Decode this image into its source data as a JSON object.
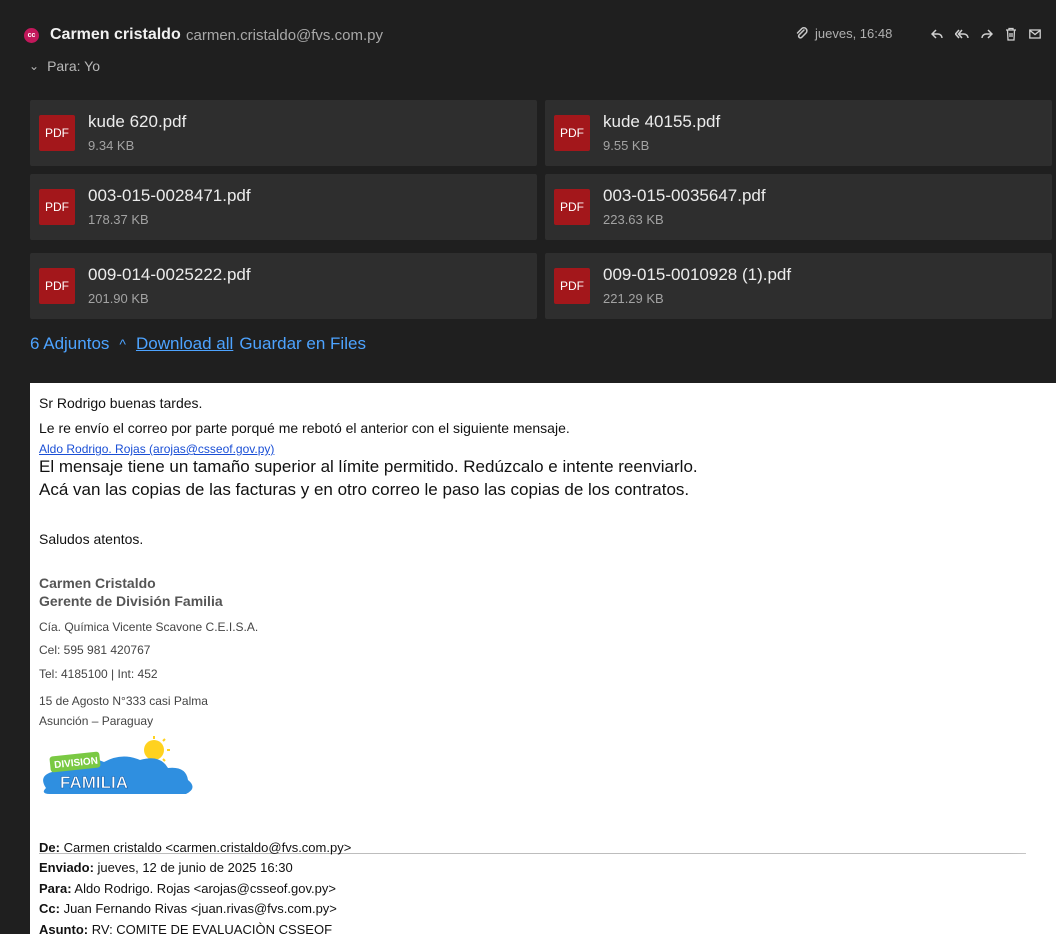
{
  "header": {
    "avatar_initials": "cc",
    "sender_name": "Carmen cristaldo",
    "sender_email": "carmen.cristaldo@fvs.com.py",
    "to_label": "Para: Yo",
    "date": "jueves, 16:48"
  },
  "attachments": [
    {
      "name": "kude 620.pdf",
      "size": "9.34 KB",
      "type": "PDF"
    },
    {
      "name": "kude 40155.pdf",
      "size": "9.55 KB",
      "type": "PDF"
    },
    {
      "name": "003-015-0028471.pdf",
      "size": "178.37 KB",
      "type": "PDF"
    },
    {
      "name": "003-015-0035647.pdf",
      "size": "223.63 KB",
      "type": "PDF"
    },
    {
      "name": "009-014-0025222.pdf",
      "size": "201.90 KB",
      "type": "PDF"
    },
    {
      "name": "009-015-0010928 (1).pdf",
      "size": "221.29 KB",
      "type": "PDF"
    }
  ],
  "attachment_bar": {
    "count_label": "6 Adjuntos",
    "download_all": "Download all",
    "save_files": "Guardar en Files"
  },
  "message": {
    "greeting": "Sr Rodrigo buenas tardes.",
    "line2": "Le re envío el correo por parte porqué me rebotó el anterior con el siguiente mensaje.",
    "link": "Aldo Rodrigo. Rojas (arojas@csseof.gov.py)",
    "error_msg": "El mensaje tiene un tamaño superior al límite permitido. Redúzcalo e intente reenviarlo.",
    "line5": "Acá van las copias de las facturas y en otro correo le paso las copias de los contratos.",
    "closing": "Saludos atentos."
  },
  "signature": {
    "name": "Carmen Cristaldo",
    "title": "Gerente de División Familia",
    "company": "Cía. Química Vicente Scavone C.E.I.S.A.",
    "cel": "Cel: 595 981 420767",
    "tel": "Tel: 4185100 | Int: 452",
    "address": "15 de Agosto N°333 casi Palma",
    "city": "Asunción – Paraguay",
    "logo_top": "DIVISION",
    "logo_bottom": "FAMILIA"
  },
  "forward": {
    "from_label": "De:",
    "from": " Carmen cristaldo <carmen.cristaldo@fvs.com.py>",
    "sent_label": "Enviado:",
    "sent": " jueves, 12 de junio de 2025 16:30",
    "to_label": "Para:",
    "to": " Aldo Rodrigo. Rojas <arojas@csseof.gov.py>",
    "cc_label": "Cc:",
    "cc": " Juan Fernando Rivas <juan.rivas@fvs.com.py>",
    "subject_label": "Asunto:",
    "subject": " RV: COMITE DE EVALUACIÒN CSSEOF"
  }
}
